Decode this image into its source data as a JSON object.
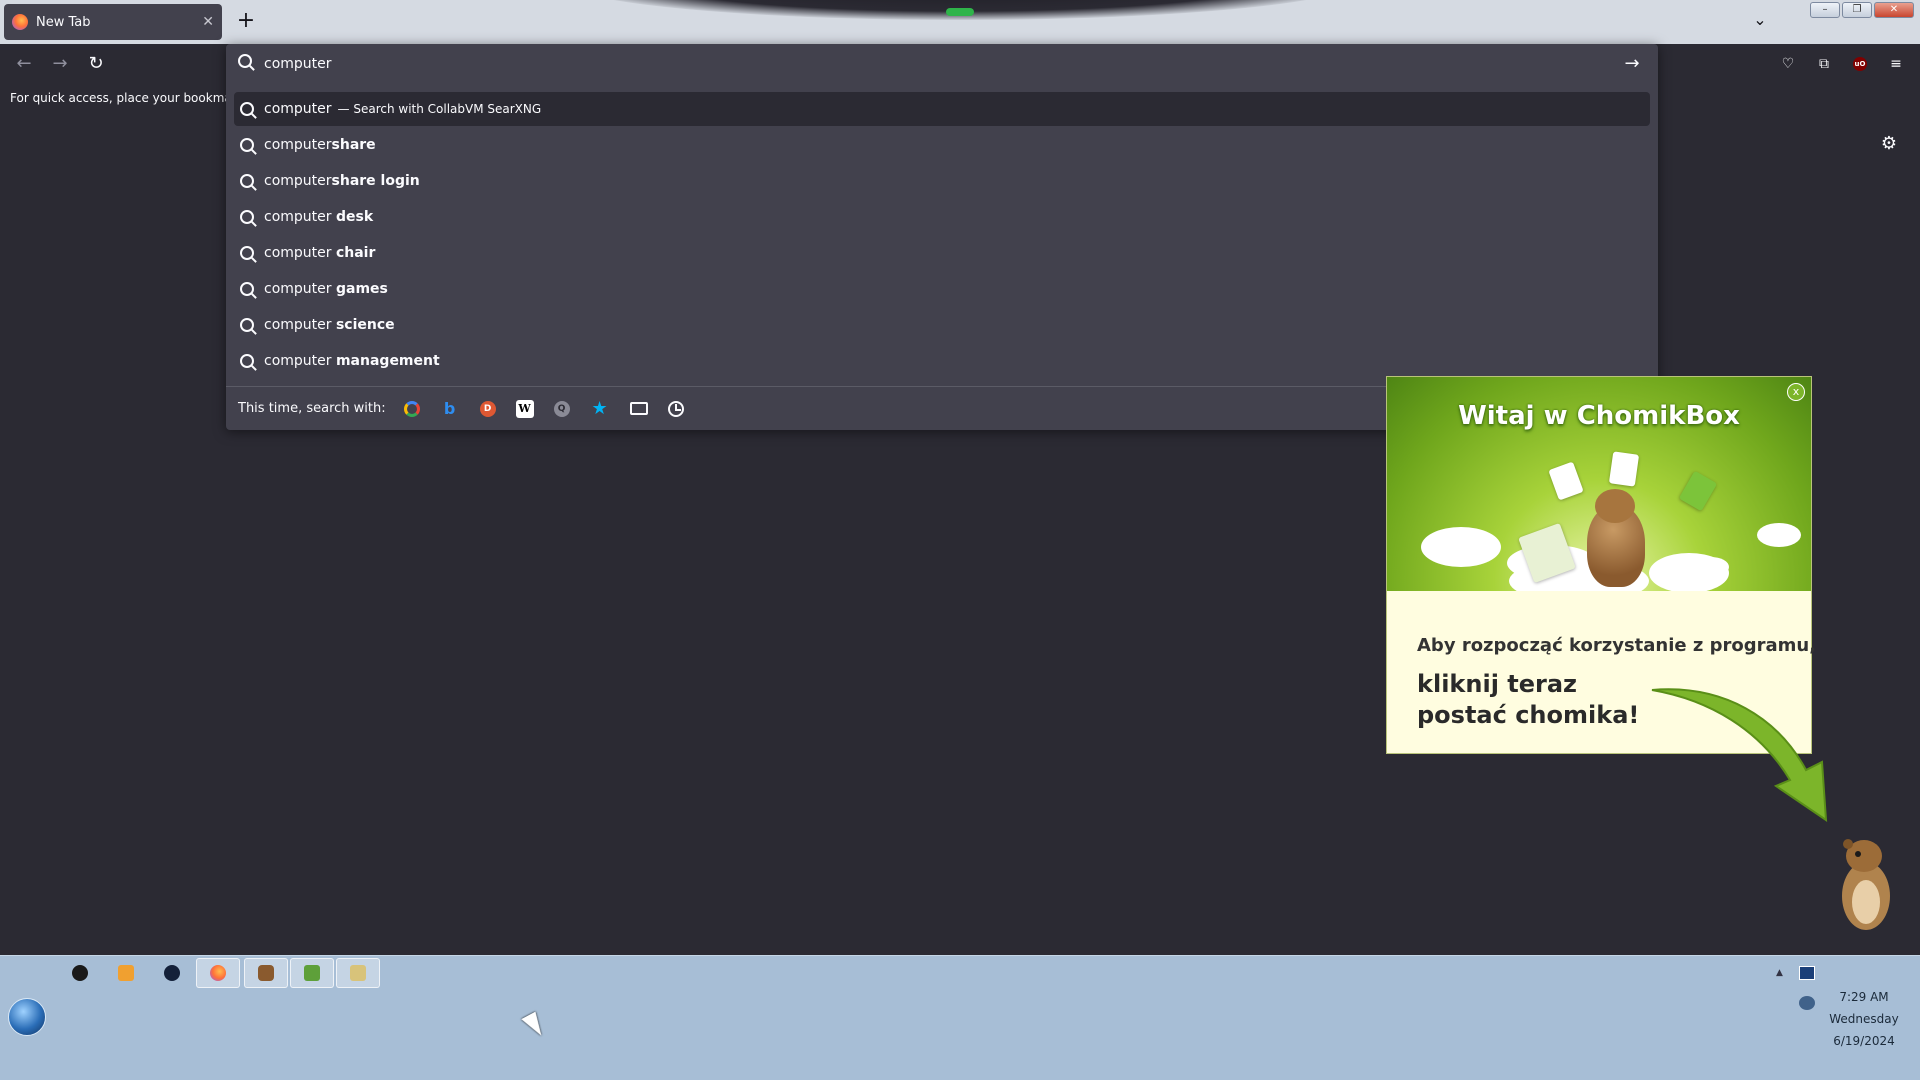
{
  "browser": {
    "tab": {
      "title": "New Tab",
      "close_glyph": "✕"
    },
    "new_tab_glyph": "+",
    "list_tabs_glyph": "⌄",
    "window_controls": {
      "minimize": "–",
      "restore": "❐",
      "close": "✕"
    },
    "nav": {
      "back_glyph": "←",
      "forward_glyph": "→",
      "reload_glyph": "↻"
    },
    "bookmarks_text": "For quick access, place your bookmarks h",
    "right_icons": {
      "pocket": "♡",
      "extensions": "⧉",
      "ublock": "uO",
      "menu": "≡"
    },
    "settings_glyph": "⚙"
  },
  "urlbar": {
    "value": "computer",
    "go_glyph": "→",
    "results": [
      {
        "prefix": "computer",
        "suffix": "",
        "action": "— Search with CollabVM SearXNG",
        "selected": true
      },
      {
        "prefix": "computer",
        "suffix": "share",
        "action": "",
        "selected": false
      },
      {
        "prefix": "computer",
        "suffix": "share login",
        "action": "",
        "selected": false
      },
      {
        "prefix": "computer ",
        "suffix": "desk",
        "action": "",
        "selected": false
      },
      {
        "prefix": "computer ",
        "suffix": "chair",
        "action": "",
        "selected": false
      },
      {
        "prefix": "computer ",
        "suffix": "games",
        "action": "",
        "selected": false
      },
      {
        "prefix": "computer ",
        "suffix": "science",
        "action": "",
        "selected": false
      },
      {
        "prefix": "computer ",
        "suffix": "management",
        "action": "",
        "selected": false
      }
    ],
    "oneoff_label": "This time, search with:",
    "engines": [
      {
        "name": "google-engine-icon",
        "glyph": ""
      },
      {
        "name": "bing-engine-icon",
        "glyph": "b"
      },
      {
        "name": "duckduckgo-engine-icon",
        "glyph": "D"
      },
      {
        "name": "wikipedia-engine-icon",
        "glyph": "W"
      },
      {
        "name": "searxng-engine-icon",
        "glyph": "Q"
      },
      {
        "name": "bookmarks-star-icon",
        "glyph": "★"
      },
      {
        "name": "tabs-icon",
        "glyph": ""
      },
      {
        "name": "history-icon",
        "glyph": ""
      }
    ]
  },
  "chomikbox": {
    "title": "Witaj w ChomikBox",
    "close_glyph": "x",
    "line1": "Aby rozpocząć korzystanie z programu,",
    "line2a": "kliknij teraz",
    "line2b": "postać chomika!",
    "colors": {
      "green": "#7cb52a",
      "panel": "#fffde0"
    }
  },
  "taskbar": {
    "clock_time": "7:29 AM",
    "clock_day": "Wednesday",
    "clock_date": "6/19/2024",
    "tray_up_glyph": "▲"
  }
}
